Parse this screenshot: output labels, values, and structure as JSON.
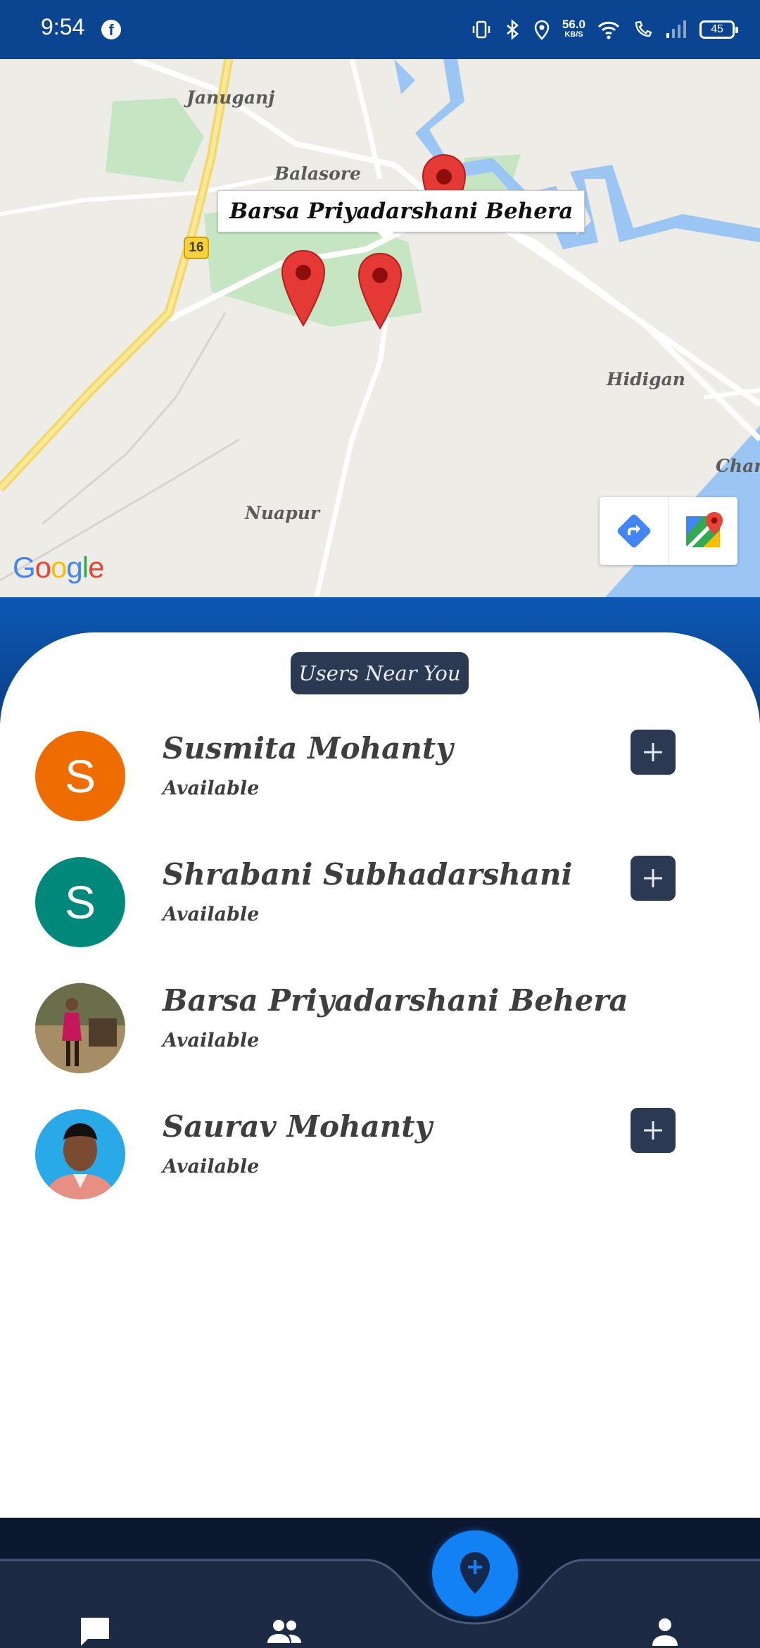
{
  "status_bar": {
    "time": "9:54",
    "facebook_glyph": "f",
    "net_speed_value": "56.0",
    "net_speed_unit": "KB/S",
    "battery": "45",
    "icons": [
      "vibrate-icon",
      "bluetooth-icon",
      "location-icon",
      "wifi-icon",
      "wifi-call-icon",
      "signal-icon",
      "battery-icon"
    ]
  },
  "map": {
    "places": {
      "januganj": "Januganj",
      "balasore": "Balasore",
      "hidigan": "Hidigan",
      "nuapur": "Nuapur",
      "chana": "Chana"
    },
    "highway_number": "16",
    "info_window_title": "Barsa Priyadarshani Behera",
    "google_logo": [
      "G",
      "o",
      "o",
      "g",
      "l",
      "e"
    ],
    "google_colors": [
      "#4285F4",
      "#EA4335",
      "#FBBC05",
      "#4285F4",
      "#34A853",
      "#EA4335"
    ],
    "tools": [
      "directions-icon",
      "google-maps-icon"
    ],
    "marker_color": "#e53935"
  },
  "nearby": {
    "title": "Users Near You",
    "users": [
      {
        "name": "Susmita Mohanty",
        "status": "Available",
        "initial": "S",
        "avatar_color": "#ef6c00",
        "has_add_button": true
      },
      {
        "name": "Shrabani Subhadarshani",
        "status": "Available",
        "initial": "S",
        "avatar_color": "#00897b",
        "has_add_button": true
      },
      {
        "name": "Barsa Priyadarshani Behera",
        "status": "Available",
        "initial": "",
        "avatar_color": "photo",
        "has_add_button": false
      },
      {
        "name": "Saurav Mohanty",
        "status": "Available",
        "initial": "",
        "avatar_color": "photo",
        "has_add_button": true
      }
    ]
  },
  "bottom_nav": {
    "items": [
      "chat-icon",
      "users-icon",
      "add-location-icon",
      "profile-icon"
    ],
    "bar_color": "#1c2a44",
    "fab_color": "#1281f4"
  }
}
